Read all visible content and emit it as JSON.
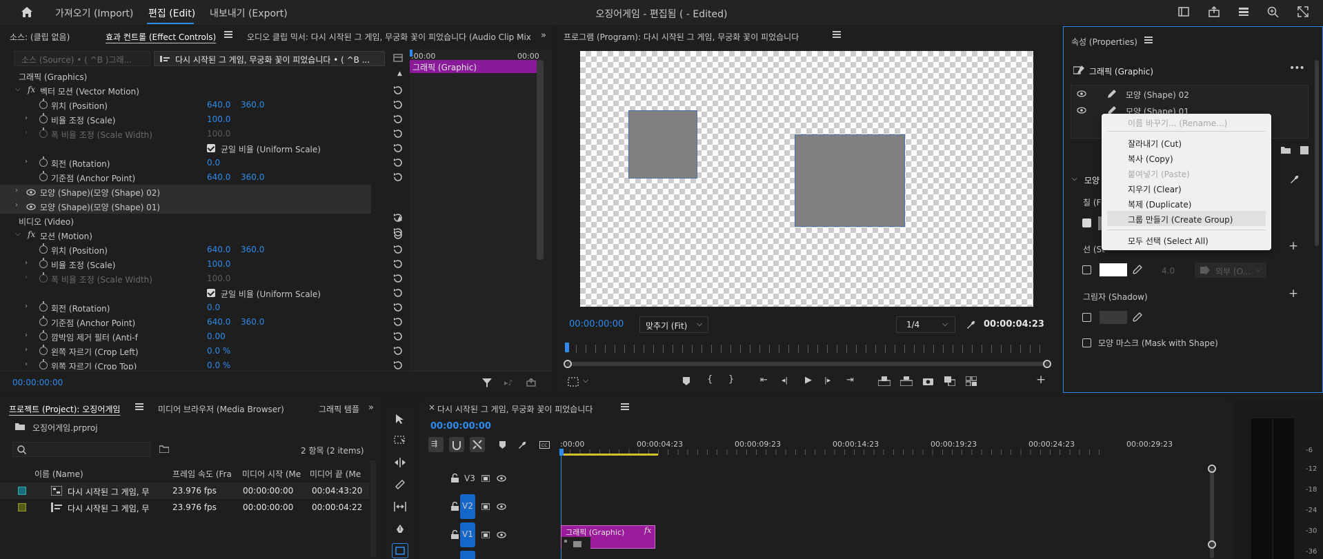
{
  "menu": {
    "import": "가져오기 (Import)",
    "edit": "편집 (Edit)",
    "export": "내보내기 (Export)",
    "title": "오징어게임 - 편집됨 ( - Edited)"
  },
  "effect_panel": {
    "tab_source": "소스: (클립 없음)",
    "tab_effect_controls": "효과 컨트롤 (Effect Controls)",
    "tab_audio_mixer": "오디오 클립 믹서: 다시 시작된 그 게임, 무궁화 꽃이 피었습니다  (Audio Clip Mix",
    "source_dropdown": "소스 (Source) • ( ^B )그래...",
    "clip_dropdown": "다시 시작된 그 게임, 무궁화 꽃이 피었습니다  • ( ^B ...",
    "time_start": ":00:00",
    "time_end": "00:00",
    "clip_bar": "그래픽 (Graphic)",
    "footer_time": "00:00:00:00",
    "graphics_header": "그래픽 (Graphics)",
    "video_header": "비디오 (Video)",
    "vector_motion": "벡터 모션 (Vector Motion)",
    "motion": "모션 (Motion)",
    "position": "위치 (Position)",
    "scale": "비율 조정 (Scale)",
    "scale_width": "폭 비율 조정 (Scale Width)",
    "uniform_scale": "균일 비율 (Uniform Scale)",
    "rotation": "회전 (Rotation)",
    "anchor": "기준점 (Anchor Point)",
    "shape02": "모양 (Shape)(모양 (Shape) 02)",
    "shape01": "모양 (Shape)(모양 (Shape) 01)",
    "anti_flicker": "깜박임 제거 필터 (Anti-f",
    "crop_left": "왼쪽 자르기 (Crop Left)",
    "crop_top": "위쪽 자르기 (Crop Top)",
    "pos_x": "640.0",
    "pos_y": "360.0",
    "scale_val": "100.0",
    "scale_width_val": "100.0",
    "rotation_val": "0.0",
    "anti_flicker_val": "0.00",
    "crop_left_val": "0.0 %",
    "crop_top_val": "0.0 %"
  },
  "program": {
    "title": "프로그램 (Program): 다시 시작된 그 게임, 무궁화 꽃이 피었습니다",
    "timecode": "00:00:00:00",
    "fit": "맞추기 (Fit)",
    "resolution": "1/4",
    "duration": "00:00:04:23"
  },
  "properties": {
    "title": "속성 (Properties)",
    "graphic": "그래픽 (Graphic)",
    "layer_shape02": "모양 (Shape) 02",
    "layer_shape01": "모양 (Shape) 01",
    "shape_section": "모양",
    "fill_label": "칠 (F",
    "stroke_label": "선 (St",
    "stroke_width": "4.0",
    "stroke_position": "외부 (O...",
    "shadow_label": "그림자 (Shadow)",
    "mask_label": "모양 마스크 (Mask with Shape)"
  },
  "context_menu": {
    "rename": "이름 바꾸기... (Rename...)",
    "cut": "잘라내기 (Cut)",
    "copy": "복사 (Copy)",
    "paste": "붙여넣기 (Paste)",
    "clear": "지우기 (Clear)",
    "duplicate": "복제 (Duplicate)",
    "create_group": "그룹 만들기 (Create Group)",
    "select_all": "모두 선택 (Select All)"
  },
  "project": {
    "tab_project": "프로젝트 (Project): 오징어게임",
    "tab_media_browser": "미디어 브라우저 (Media Browser)",
    "tab_graphics_templates": "그래픽 템플",
    "file_name": "오징어게임.prproj",
    "item_count": "2 항목 (2 items)",
    "col_name": "이름 (Name)",
    "col_framerate": "프레임 속도 (Fra",
    "col_media_start": "미디어 시작 (Me",
    "col_media_end": "미디어 끝 (Me",
    "rows": [
      {
        "name": "다시 시작된 그 게임, 무",
        "fps": "23.976 fps",
        "start": "00:00:00:00",
        "end": "00:04:43:20",
        "color": "#1b6a7a"
      },
      {
        "name": "다시 시작된 그 게임, 무",
        "fps": "23.976 fps",
        "start": "00:00:00:00",
        "end": "00:00:04:22",
        "color": "#5a5a18"
      }
    ]
  },
  "timeline": {
    "title": "다시 시작된 그 게임, 무궁화 꽃이 피었습니다",
    "timecode": "00:00:00:00",
    "ruler": [
      ":00:00",
      "00:00:04:23",
      "00:00:09:23",
      "00:00:14:23",
      "00:00:19:23",
      "00:00:24:23",
      "00:00:29:23"
    ],
    "tracks": [
      "V3",
      "V2",
      "V1"
    ],
    "clip_label": "그래픽 (Graphic)",
    "clip_fx": "fx"
  },
  "meter": {
    "labels": [
      "-6",
      "-12",
      "-18",
      "-24",
      "-30",
      "-36"
    ]
  },
  "colors": {
    "accent": "#2d8ceb",
    "clip_purple": "#9a1c9a",
    "timeline_bar": "#cfc22a"
  }
}
